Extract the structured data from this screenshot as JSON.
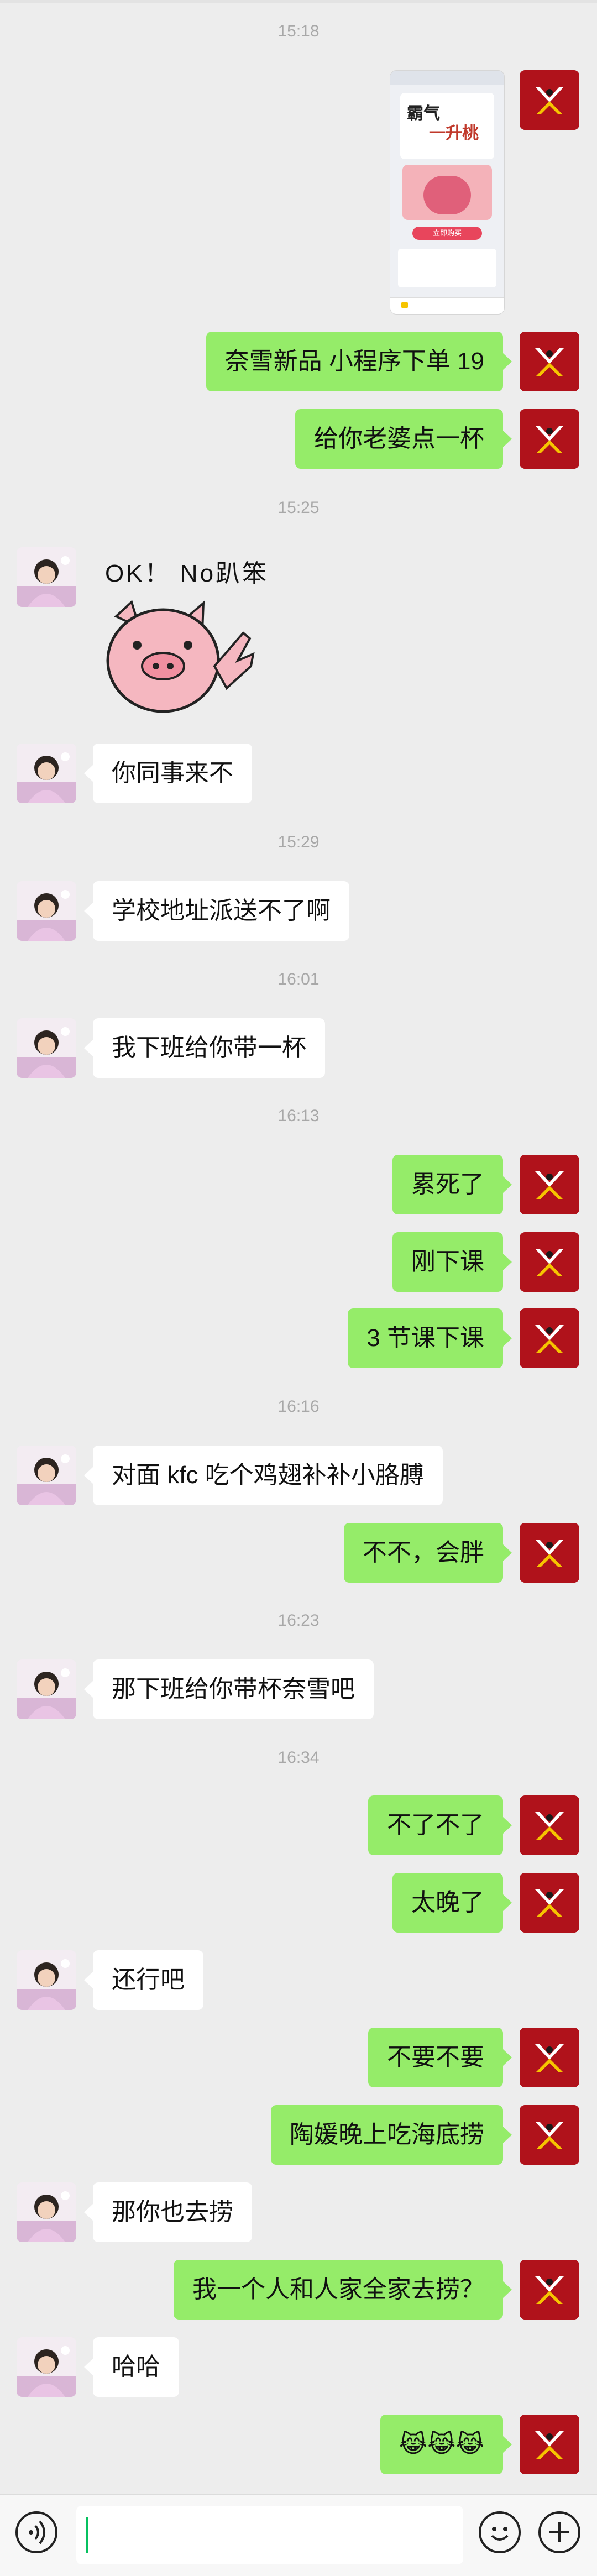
{
  "chat": {
    "timestamps": {
      "t1": "15:18",
      "t2": "15:25",
      "t3": "15:29",
      "t4": "16:01",
      "t5": "16:13",
      "t6": "16:16",
      "t7": "16:23",
      "t8": "16:34"
    },
    "messages": {
      "m1": "奈雪新品 小程序下单 19",
      "m2": "给你老婆点一杯",
      "m3": "OK！ No趴笨",
      "m4": "你同事来不",
      "m5": "学校地址派送不了啊",
      "m6": "我下班给你带一杯",
      "m7": "累死了",
      "m8": "刚下课",
      "m9": "3 节课下课",
      "m10": "对面 kfc 吃个鸡翅补补小胳膊",
      "m11": "不不，会胖",
      "m12": "那下班给你带杯奈雪吧",
      "m13": "不了不了",
      "m14": "太晚了",
      "m15": "还行吧",
      "m16": "不要不要",
      "m17": "陶媛晚上吃海底捞",
      "m18": "那你也去捞",
      "m19": "我一个人和人家全家去捞？",
      "m20": "哈哈",
      "m21": "😹😹😹"
    },
    "screenshot": {
      "headline": "霸气",
      "subheadline": "一升桃",
      "button": "立即购买"
    }
  },
  "colors": {
    "background": "#ededed",
    "my_bubble": "#95ec69",
    "their_bubble": "#ffffff",
    "my_avatar": "#b0121b",
    "cursor": "#07c160"
  },
  "icons": {
    "voice": "voice-icon",
    "emoji": "emoji-icon",
    "plus": "plus-icon",
    "pig": "pig-sticker-icon"
  }
}
